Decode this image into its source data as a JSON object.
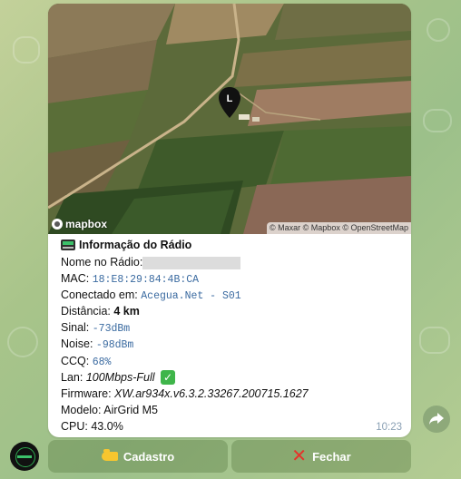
{
  "map": {
    "logo_text": "mapbox",
    "attribution": "© Maxar © Mapbox © OpenStreetMap",
    "pin_label": "L"
  },
  "info": {
    "title": "Informação do Rádio",
    "nome_label": "Nome no Rádio:",
    "mac_label": "MAC:",
    "mac_value": "18:E8:29:84:4B:CA",
    "conectado_label": "Conectado em:",
    "conectado_value": "Acegua.Net - S01",
    "distancia_label": "Distância:",
    "distancia_value": "4 km",
    "sinal_label": "Sinal:",
    "sinal_value": "-73dBm",
    "noise_label": "Noise:",
    "noise_value": "-98dBm",
    "ccq_label": "CCQ:",
    "ccq_value": "68%",
    "lan_label": "Lan:",
    "lan_value": "100Mbps-Full",
    "firmware_label": "Firmware:",
    "firmware_value": "XW.ar934x.v6.3.2.33267.200715.1627",
    "modelo_label": "Modelo:",
    "modelo_value": "AirGrid M5",
    "cpu_label": "CPU:",
    "cpu_value": "43.0%"
  },
  "message": {
    "time": "10:23"
  },
  "buttons": {
    "cadastro": "Cadastro",
    "fechar": "Fechar"
  },
  "icons": {
    "radio": "radio-icon",
    "check": "check-mark-icon",
    "share": "share-arrow-icon",
    "cadastro": "pointing-hand-icon",
    "fechar": "cross-mark-icon"
  },
  "colors": {
    "link": "#3a6aa0",
    "button_bg": "#607f48",
    "check": "#3fb54a",
    "cross": "#e5332a"
  }
}
